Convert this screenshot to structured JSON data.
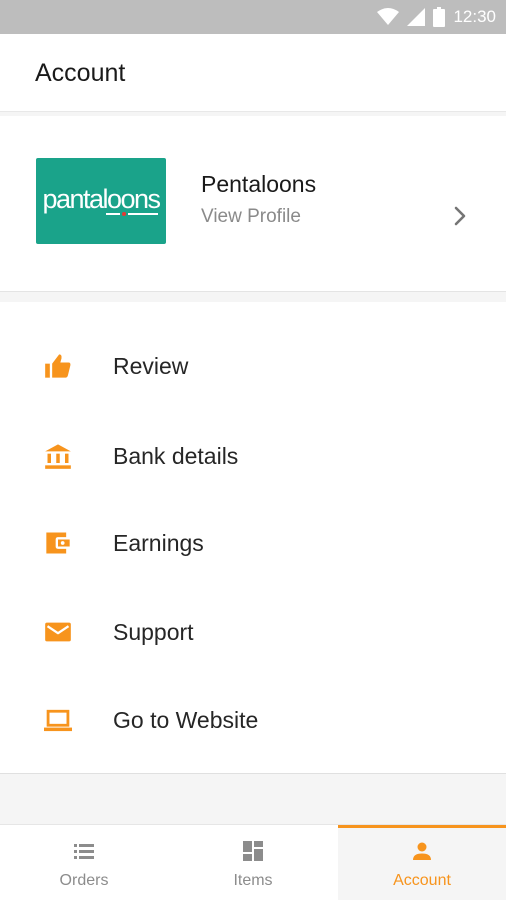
{
  "status_bar": {
    "time": "12:30"
  },
  "header": {
    "title": "Account"
  },
  "profile": {
    "logo_text": "pantaloons",
    "name": "Pentaloons",
    "subtitle": "View Profile"
  },
  "menu": {
    "items": [
      {
        "label": "Review",
        "icon": "thumbs-up-icon"
      },
      {
        "label": "Bank details",
        "icon": "bank-icon"
      },
      {
        "label": "Earnings",
        "icon": "wallet-icon"
      },
      {
        "label": "Support",
        "icon": "mail-icon"
      },
      {
        "label": "Go to Website",
        "icon": "laptop-icon"
      }
    ]
  },
  "bottom_nav": {
    "tabs": [
      {
        "label": "Orders",
        "icon": "list-icon",
        "active": false
      },
      {
        "label": "Items",
        "icon": "dashboard-icon",
        "active": false
      },
      {
        "label": "Account",
        "icon": "person-icon",
        "active": true
      }
    ]
  },
  "colors": {
    "accent": "#f7941d",
    "logo_bg": "#1aa38a",
    "status_bar": "#bdbdbd"
  }
}
